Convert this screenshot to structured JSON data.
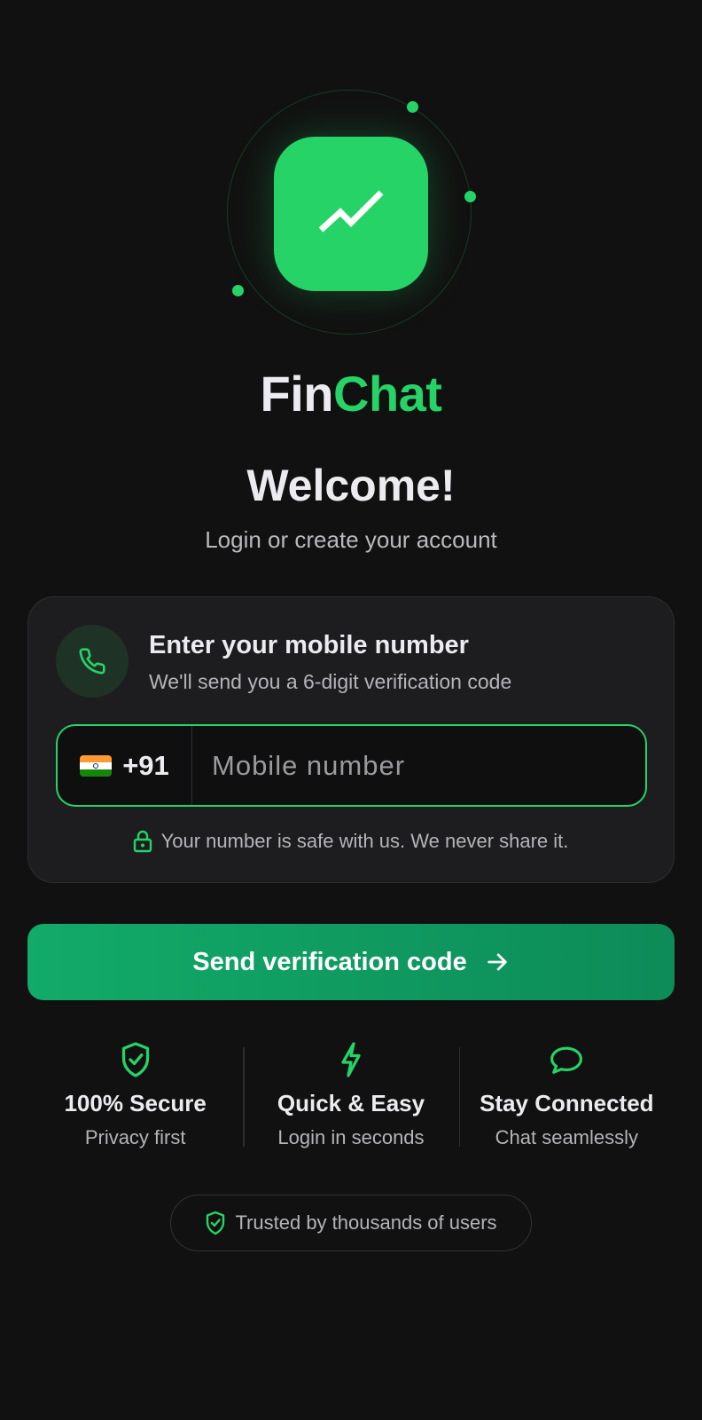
{
  "brand": {
    "name_part_1": "Fin",
    "name_part_2": "Chat",
    "icon": "trend-up-icon",
    "accent_color": "#25d366"
  },
  "welcome": {
    "title": "Welcome!",
    "subtitle": "Login or create your account"
  },
  "phone_card": {
    "icon": "phone-icon",
    "title": "Enter your mobile number",
    "description": "We'll send you a 6-digit verification code",
    "country_flag": "india-flag",
    "country_code": "+91",
    "input_value": "",
    "input_placeholder": "Mobile number",
    "safe_note_icon": "lock-icon",
    "safe_note": "Your number is safe with us. We never share it."
  },
  "send_button": {
    "label": "Send verification code",
    "icon": "arrow-right-icon"
  },
  "features": [
    {
      "icon": "shield-check-icon",
      "title": "100% Secure",
      "subtitle": "Privacy first"
    },
    {
      "icon": "lightning-icon",
      "title": "Quick & Easy",
      "subtitle": "Login in seconds"
    },
    {
      "icon": "chat-bubble-icon",
      "title": "Stay Connected",
      "subtitle": "Chat seamlessly"
    }
  ],
  "trust_badge": {
    "icon": "shield-check-icon",
    "label": "Trusted by thousands of users"
  }
}
